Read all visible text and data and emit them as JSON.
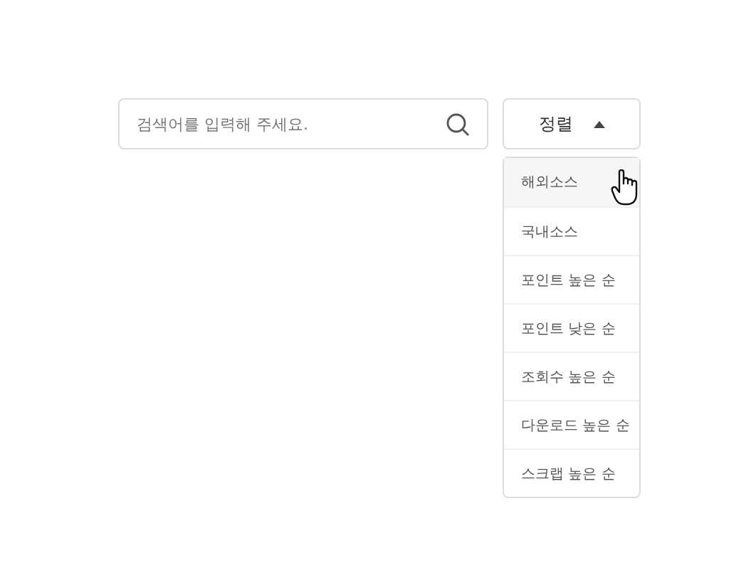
{
  "search": {
    "placeholder": "검색어를 입력해 주세요."
  },
  "sort_button": {
    "label": "정렬",
    "expanded": true
  },
  "sort_menu": [
    {
      "label": "해외소스",
      "hovered": true
    },
    {
      "label": "국내소스",
      "hovered": false
    },
    {
      "label": "포인트 높은 순",
      "hovered": false
    },
    {
      "label": "포인트 낮은 순",
      "hovered": false
    },
    {
      "label": "조회수 높은 순",
      "hovered": false
    },
    {
      "label": "다운로드 높은 순",
      "hovered": false
    },
    {
      "label": "스크랩 높은 순",
      "hovered": false
    }
  ]
}
